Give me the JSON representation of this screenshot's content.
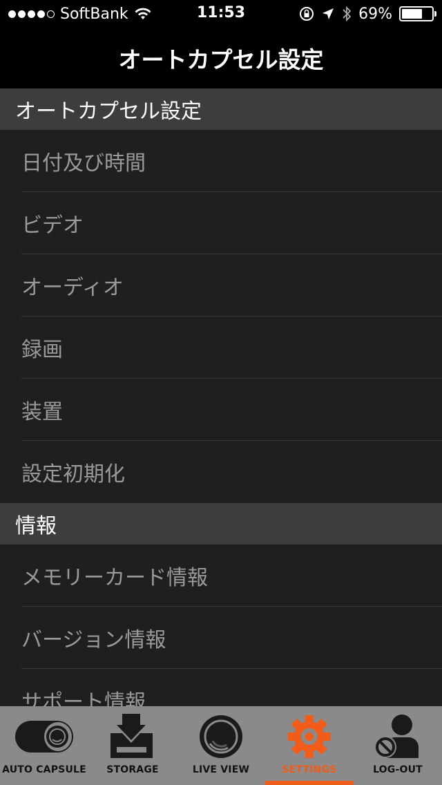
{
  "status_bar": {
    "carrier": "SoftBank",
    "time": "11:53",
    "battery_percent": "69%",
    "battery_level": 0.69,
    "signal_bars_filled": 4,
    "signal_bars_total": 5
  },
  "nav": {
    "title": "オートカプセル設定"
  },
  "sections": [
    {
      "header": "オートカプセル設定",
      "items": [
        "日付及び時間",
        "ビデオ",
        "オーディオ",
        "録画",
        "装置",
        "設定初期化"
      ]
    },
    {
      "header": "情報",
      "items": [
        "メモリーカード情報",
        "バージョン情報",
        "サポート情報"
      ]
    }
  ],
  "tab_bar": {
    "tabs": [
      {
        "label": "AUTO CAPSULE",
        "icon": "auto-capsule-icon"
      },
      {
        "label": "STORAGE",
        "icon": "storage-icon"
      },
      {
        "label": "LIVE VIEW",
        "icon": "live-view-icon"
      },
      {
        "label": "SETTINGS",
        "icon": "settings-gear-icon",
        "active": true
      },
      {
        "label": "LOG-OUT",
        "icon": "logout-user-icon"
      }
    ],
    "active_color": "#f25c19"
  }
}
